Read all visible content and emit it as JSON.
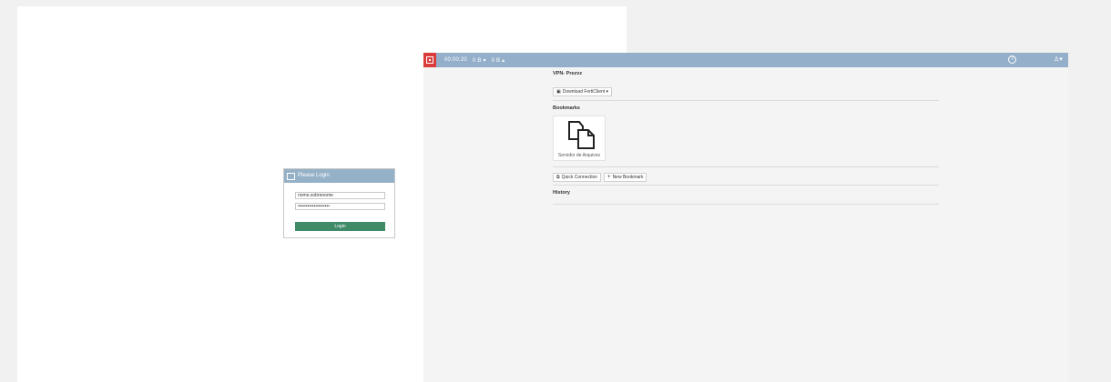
{
  "login": {
    "title": "Please Login",
    "username_value": "nome.sobrenome",
    "password_value": "••••••••••••••••••••",
    "login_label": "Login"
  },
  "portal": {
    "topbar": {
      "timer": "00:00:20",
      "stat1": "0 B ▾",
      "stat2": "0 B ▴",
      "help_glyph": "?",
      "user_glyph": "♙▾"
    },
    "page_title": "VPN- Prezvz",
    "download_label": "Download FortiClient ▾",
    "bookmarks_title": "Bookmarks",
    "bookmark_label": "Servidor de Arquivos",
    "quick_connection_label": "Quick Connection",
    "new_bookmark_label": "New Bookmark",
    "history_title": "History"
  },
  "colors": {
    "topbar": "#93afc9",
    "brand": "#da3b3b",
    "login_button": "#3f8a67"
  }
}
